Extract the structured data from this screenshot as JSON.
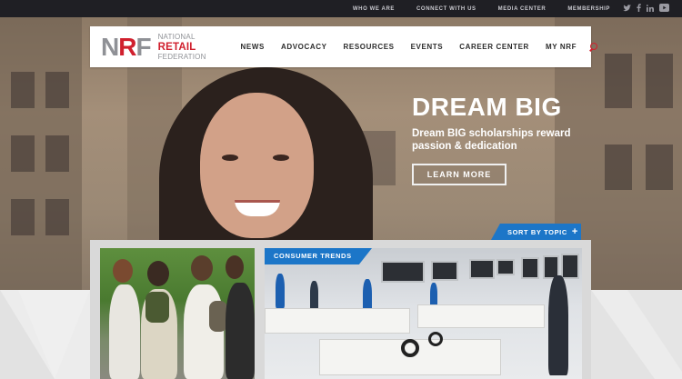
{
  "topbar": {
    "links": [
      "WHO WE ARE",
      "CONNECT WITH US",
      "MEDIA CENTER",
      "MEMBERSHIP"
    ],
    "social": {
      "twitter": "twitter-icon",
      "facebook": "facebook-icon",
      "linkedin": "linkedin-icon",
      "youtube": "youtube-icon"
    }
  },
  "logo": {
    "mark_n": "N",
    "mark_r": "R",
    "mark_f": "F",
    "line1": "NATIONAL",
    "line2": "RETAIL",
    "line3": "FEDERATION"
  },
  "nav": {
    "items": [
      "NEWS",
      "ADVOCACY",
      "RESOURCES",
      "EVENTS",
      "CAREER CENTER",
      "MY NRF"
    ],
    "search_icon": "search-icon"
  },
  "hero": {
    "title": "DREAM BIG",
    "subtitle": "Dream BIG scholarships reward passion & dedication",
    "button": "LEARN MORE"
  },
  "sort": {
    "label": "SORT BY TOPIC",
    "plus": "+"
  },
  "cards": [
    {
      "topic": ""
    },
    {
      "topic": "CONSUMER TRENDS"
    }
  ],
  "colors": {
    "brand_red": "#d0202e",
    "accent_blue": "#1c76c8",
    "topbar": "#1f1f24"
  }
}
